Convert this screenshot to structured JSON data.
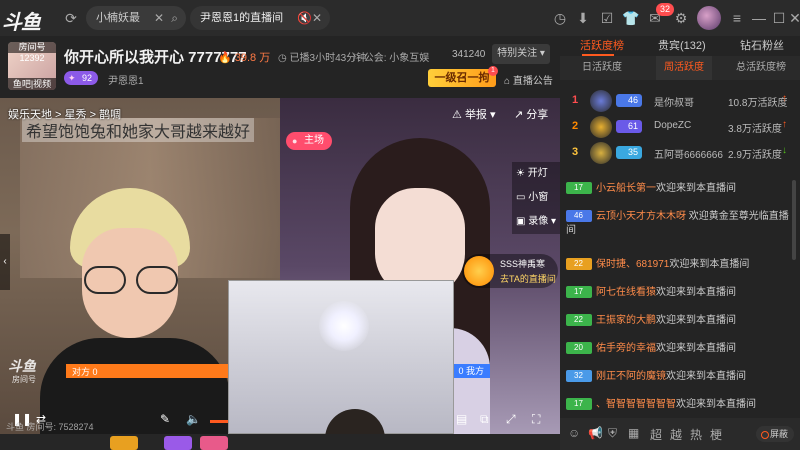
{
  "topbar": {
    "logo": "斗鱼",
    "tabs": [
      {
        "label": "小楠妖最"
      },
      {
        "label": "尹恩恩1的直播间"
      }
    ],
    "notify_count": "32"
  },
  "room": {
    "avatar_label": "房间号",
    "room_id": "12392",
    "category_tag": "鱼吧|视频",
    "title": "你开心所以我开心 7777777",
    "heat": "39.8 万",
    "live_time": "已播3小时43分钟",
    "guild": "公会: 小象互娱",
    "follow_count": "341240",
    "follow_label": "特别关注 ▾",
    "level": "92",
    "owner": "尹恩恩1",
    "promo": "一级召一拘",
    "promo_badge": "1",
    "announce": "直播公告"
  },
  "video": {
    "breadcrumb": "娱乐天地  >  星秀  >  鹊啁",
    "caption": "希望饱饱兔和她家大哥越来越好",
    "report": "举报 ▾",
    "share": "分享",
    "host_tag": "主场",
    "side_controls": [
      "开灯",
      "小窗",
      "录像 ▾"
    ],
    "pk_user_name": "SSS神禹寒",
    "pk_user_link": "去TA的直播间",
    "pk_left_label": "对方 0",
    "pk_right_label": "0 我方",
    "pk_left_pct": 52,
    "pk_right_pct": 48,
    "watermark": "斗鱼",
    "watermark_sub": "房间号",
    "room_url": "斗鱼 房间号: 7528274"
  },
  "panel": {
    "tabs": [
      "活跃度榜",
      "贵宾(132)",
      "钻石粉丝"
    ],
    "subtabs": [
      "日活跃度",
      "周活跃度",
      "总活跃度榜"
    ],
    "ranks": [
      {
        "num": "1",
        "lv": "46",
        "name": "是你叔哥",
        "score": "10.8万活跃度",
        "trend": "↑",
        "num_color": "#ff4d4f",
        "medal": "#6a7bd8",
        "lv_color": "#4a78e8",
        "trend_color": "#ff5a1f"
      },
      {
        "num": "2",
        "lv": "61",
        "name": "DopeZC",
        "score": "3.8万活跃度",
        "trend": "↑",
        "num_color": "#ff8a00",
        "medal": "#e8b030",
        "lv_color": "#6a5ae8",
        "trend_color": "#ff5a1f"
      },
      {
        "num": "3",
        "lv": "35",
        "name": "五阿哥6666666",
        "score": "2.9万活跃度",
        "trend": "↓",
        "num_color": "#ffc53d",
        "medal": "#d8b040",
        "lv_color": "#3aa8e0",
        "trend_color": "#52c41a"
      }
    ],
    "chat": [
      {
        "badge": "17",
        "badge_color": "#3cb44b",
        "name": "小云船长第一",
        "text": "欢迎来到本直播间"
      },
      {
        "badge": "46",
        "badge_color": "#4a78e8",
        "name": "云顶小天才方木木呀",
        "text": "欢迎黄金至尊光临直播间"
      },
      {
        "badge": "22",
        "badge_color": "#e8a020",
        "name": "保时捷、681971",
        "text": "欢迎来到本直播间"
      },
      {
        "badge": "17",
        "badge_color": "#3cb44b",
        "name": "阿七在线看猿",
        "text": "欢迎来到本直播间"
      },
      {
        "badge": "22",
        "badge_color": "#3cb44b",
        "name": "王振家的大鹏",
        "text": "欢迎来到本直播间"
      },
      {
        "badge": "20",
        "badge_color": "#3cb44b",
        "name": "佑手旁的幸福",
        "text": "欢迎来到本直播间"
      },
      {
        "badge": "32",
        "badge_color": "#4a9ae8",
        "name": "刚正不阿的魔镜",
        "text": "欢迎来到本直播间"
      },
      {
        "badge": "17",
        "badge_color": "#3cb44b",
        "name": "、智智智智智智智",
        "text": "欢迎来到本直播间"
      }
    ],
    "chat_tools": [
      "超",
      "越",
      "热",
      "梗"
    ],
    "block_label": "屏蔽"
  }
}
